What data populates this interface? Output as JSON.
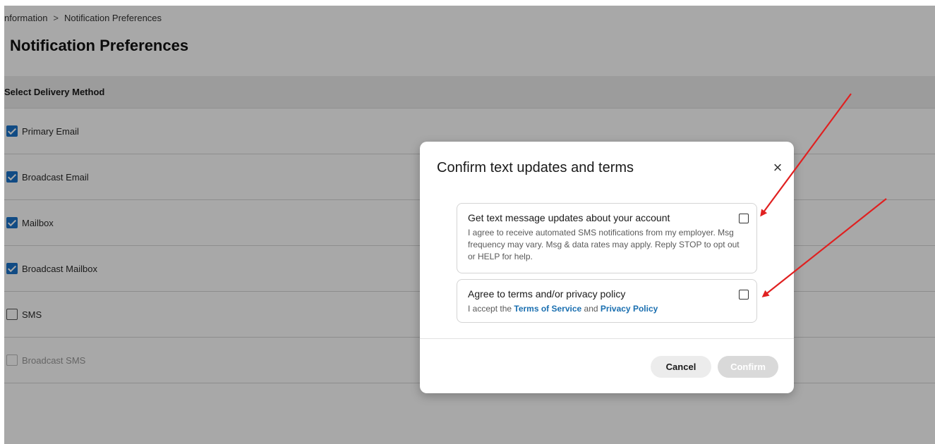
{
  "breadcrumb": {
    "parent": "nformation",
    "separator": ">",
    "current": "Notification Preferences"
  },
  "page": {
    "title": "Notification Preferences"
  },
  "table": {
    "header": "Select Delivery Method",
    "rows": [
      {
        "label": "Primary Email",
        "checked": true,
        "disabled": false
      },
      {
        "label": "Broadcast Email",
        "checked": true,
        "disabled": false
      },
      {
        "label": "Mailbox",
        "checked": true,
        "disabled": false
      },
      {
        "label": "Broadcast Mailbox",
        "checked": true,
        "disabled": false
      },
      {
        "label": "SMS",
        "checked": false,
        "disabled": false
      },
      {
        "label": "Broadcast SMS",
        "checked": false,
        "disabled": true
      }
    ]
  },
  "modal": {
    "title": "Confirm text updates and terms",
    "close_glyph": "×",
    "sms_consent": {
      "title": "Get text message updates about your account",
      "description": "I agree to receive automated SMS notifications from my employer. Msg frequency may vary. Msg & data rates may apply. Reply STOP to opt out or HELP for help.",
      "checked": false
    },
    "terms_consent": {
      "title": "Agree to terms and/or privacy policy",
      "desc_prefix": "I accept the ",
      "terms_link": "Terms of Service",
      "desc_middle": " and ",
      "privacy_link": "Privacy Policy",
      "checked": false
    },
    "cancel_label": "Cancel",
    "confirm_label": "Confirm"
  },
  "colors": {
    "accent": "#1a73c8",
    "link": "#1a6fb0",
    "annotation_arrow": "#e02020",
    "confirm_disabled_bg": "#d9d9d9"
  }
}
